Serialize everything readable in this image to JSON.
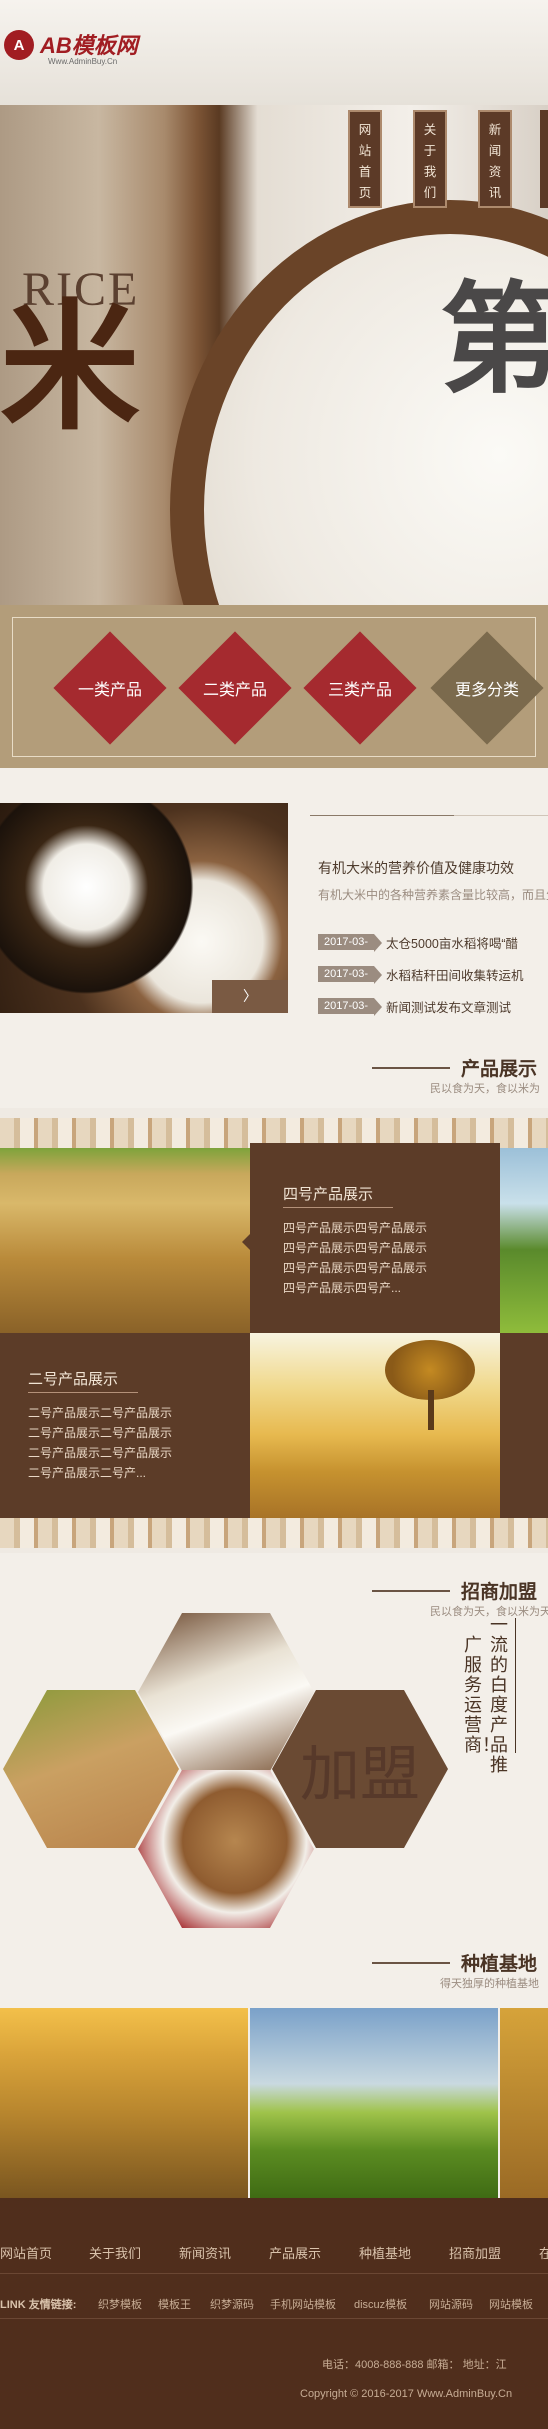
{
  "header": {
    "logo_mark": "A",
    "logo_text": "AB模板网",
    "logo_sub": "Www.AdminBuy.Cn"
  },
  "nav": [
    {
      "label_chars": [
        "网",
        "站",
        "首",
        "页"
      ]
    },
    {
      "label_chars": [
        "关",
        "于",
        "我",
        "们"
      ]
    },
    {
      "label_chars": [
        "新",
        "闻",
        "资",
        "讯"
      ]
    }
  ],
  "banner": {
    "rice": "RICE",
    "mi": "米",
    "headline": "第"
  },
  "categories": [
    {
      "label": "一类产品",
      "color": "#a52a2f"
    },
    {
      "label": "二类产品",
      "color": "#a52a2f"
    },
    {
      "label": "三类产品",
      "color": "#a52a2f"
    },
    {
      "label": "更多分类",
      "color": "#7b6a4d"
    }
  ],
  "news": {
    "more": "〉",
    "title": "有机大米的营养价值及健康功效",
    "desc": "有机大米中的各种营养素含量比较高，而且生素的主要来源。有机大米粥具有补脾、和",
    "items": [
      {
        "date": "2017-03-",
        "text": "太仓5000亩水稻将喝“醋"
      },
      {
        "date": "2017-03-",
        "text": "水稻秸秆田间收集转运机"
      },
      {
        "date": "2017-03-",
        "text": "新闻测试发布文章测试"
      }
    ]
  },
  "products": {
    "heading": "产品展示",
    "sub": "民以食为天，食以米为",
    "p4": {
      "title": "四号产品展示",
      "lines": [
        "四号产品展示四号产品展示",
        "四号产品展示四号产品展示",
        "四号产品展示四号产品展示",
        "四号产品展示四号产..."
      ]
    },
    "p2": {
      "title": "二号产品展示",
      "lines": [
        "二号产品展示二号产品展示",
        "二号产品展示二号产品展示",
        "二号产品展示二号产品展示",
        "二号产品展示二号产..."
      ]
    }
  },
  "zs": {
    "heading": "招商加盟",
    "sub": "民以食为天，食以米为天",
    "col1": "广服务运营商！",
    "col2": "一流的白度产品推",
    "seal": "加盟"
  },
  "jd": {
    "heading": "种植基地",
    "sub": "得天独厚的种植基地"
  },
  "footer": {
    "nav": [
      "网站首页",
      "关于我们",
      "新闻资讯",
      "产品展示",
      "种植基地",
      "招商加盟",
      "在"
    ],
    "link_label": "LINK 友情链接:",
    "links": [
      "织梦模板",
      "模板王",
      "织梦源码",
      "手机网站模板",
      "discuz模板",
      "网站源码",
      "网站模板"
    ],
    "contact": "电话：4008-888-888   邮箱：   地址：江",
    "copyright": "Copyright © 2016-2017 Www.AdminBuy.Cn"
  }
}
